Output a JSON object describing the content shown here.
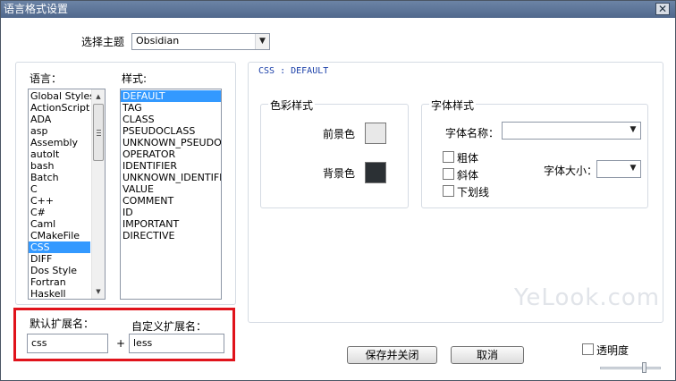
{
  "window": {
    "title": "语言格式设置",
    "close_label": "✕"
  },
  "theme": {
    "label": "选择主题",
    "value": "Obsidian"
  },
  "languages": {
    "label": "语言：",
    "items": [
      "Global Styles",
      "ActionScript",
      "ADA",
      "asp",
      "Assembly",
      "autoIt",
      "bash",
      "Batch",
      "C",
      "C++",
      "C#",
      "Caml",
      "CMakeFile",
      "CSS",
      "DIFF",
      "Dos Style",
      "Fortran",
      "Haskell"
    ],
    "selected": "CSS"
  },
  "styles": {
    "label": "样式:",
    "items": [
      "DEFAULT",
      "TAG",
      "CLASS",
      "PSEUDOCLASS",
      "UNKNOWN_PSEUDOCL",
      "OPERATOR",
      "IDENTIFIER",
      "UNKNOWN_IDENTIFIE",
      "VALUE",
      "COMMENT",
      "ID",
      "IMPORTANT",
      "DIRECTIVE"
    ],
    "selected": "DEFAULT"
  },
  "panel": {
    "heading": "CSS : DEFAULT"
  },
  "color_style": {
    "title": "色彩样式",
    "foreground_label": "前景色",
    "background_label": "背景色",
    "foreground_color": "#e8e8e8",
    "background_color": "#2b3034"
  },
  "font_style": {
    "title": "字体样式",
    "name_label": "字体名称：",
    "name_value": "",
    "bold_label": "粗体",
    "italic_label": "斜体",
    "underline_label": "下划线",
    "size_label": "字体大小：",
    "size_value": ""
  },
  "extensions": {
    "default_label": "默认扩展名：",
    "custom_label": "自定义扩展名：",
    "default_value": "css",
    "plus": "+",
    "custom_value": "less",
    "highlight_color": "#e0131b"
  },
  "buttons": {
    "save_close": "保存并关闭",
    "cancel": "取消"
  },
  "transparency": {
    "label": "透明度"
  },
  "watermark": "YeLook.com"
}
